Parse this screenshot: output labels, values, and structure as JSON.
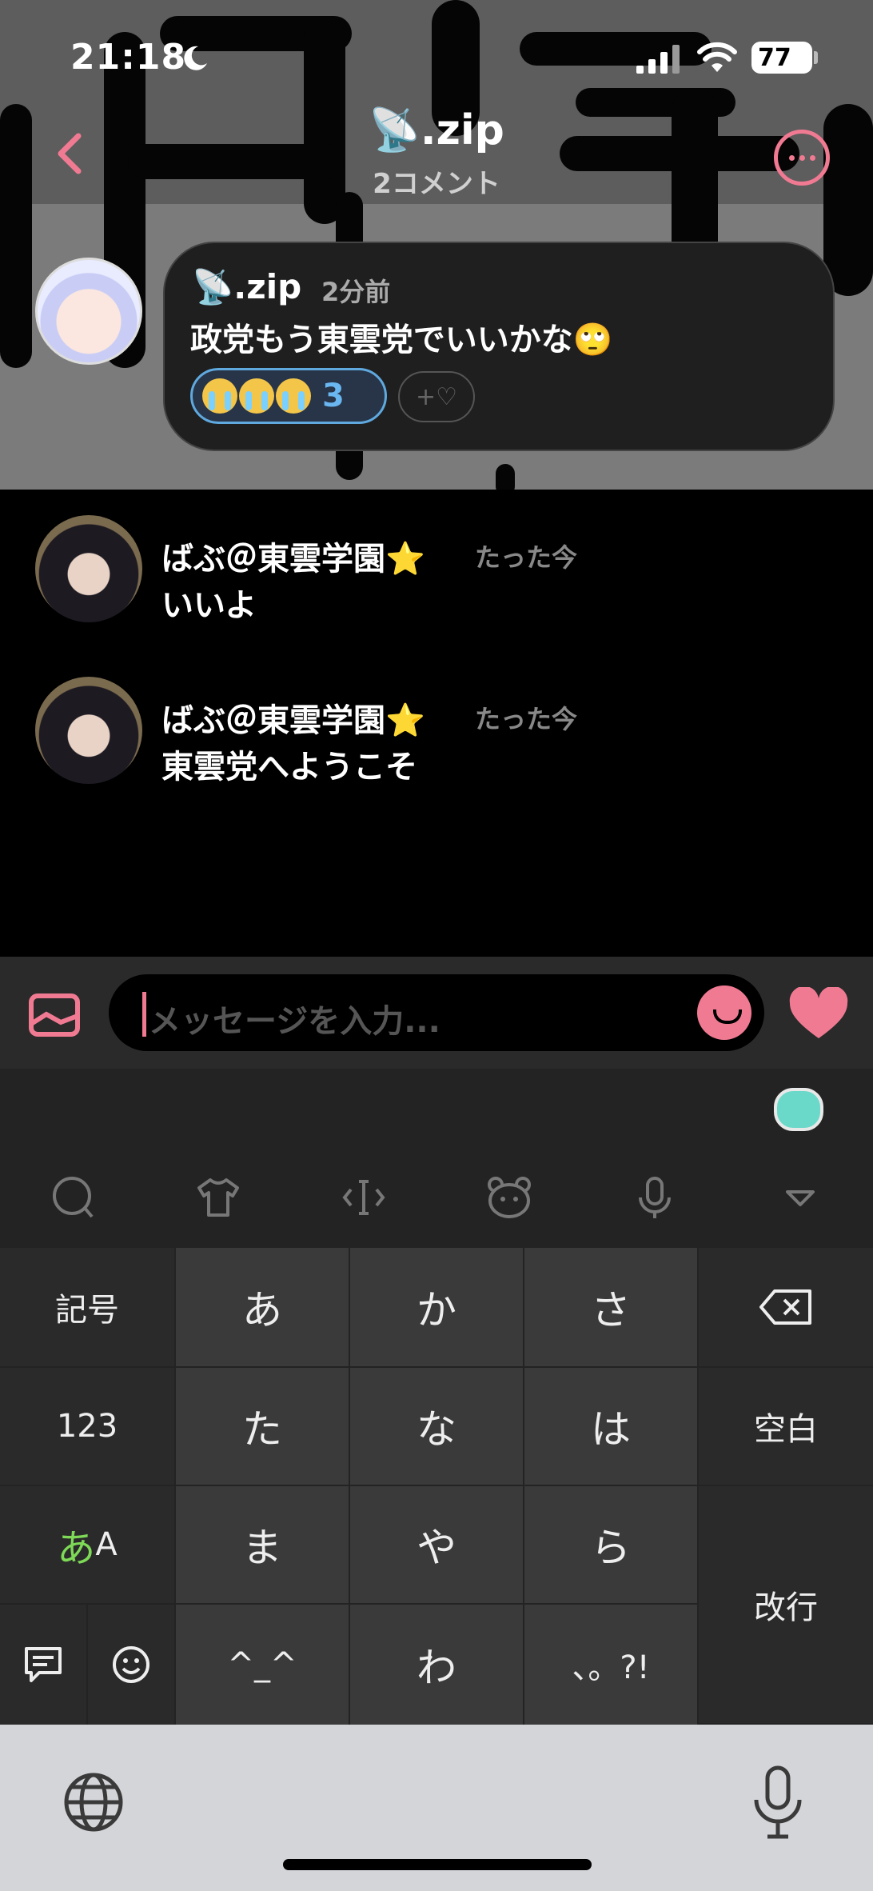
{
  "status_bar": {
    "time": "21:18",
    "battery": "77"
  },
  "nav": {
    "title": "📡.zip",
    "subtitle": "2コメント"
  },
  "post": {
    "author": "📡.zip",
    "time": "2分前",
    "text": "政党もう東雲党でいいかな🙄",
    "reaction_count": "3",
    "add_reaction_label": "+♡"
  },
  "comments": [
    {
      "author": "ばぶ＠東雲学園⭐",
      "time": "たった今",
      "text": "いいよ"
    },
    {
      "author": "ばぶ＠東雲学園⭐",
      "time": "たった今",
      "text": "東雲党へようこそ"
    }
  ],
  "input": {
    "placeholder": "メッセージを入力..."
  },
  "keyboard": {
    "keys": {
      "symbols": "記号",
      "a": "あ",
      "ka": "か",
      "sa": "さ",
      "num": "123",
      "ta": "た",
      "na": "な",
      "ha": "は",
      "space": "空白",
      "kana_a": "あ",
      "kana_A": "A",
      "ma": "ま",
      "ya": "や",
      "ra": "ら",
      "return": "改行",
      "face": "^_^",
      "wa": "わ",
      "punct": "、。?!"
    }
  },
  "colors": {
    "accent": "#f17a93",
    "reaction_border": "#5fa9df",
    "kana_green": "#7ed957"
  }
}
